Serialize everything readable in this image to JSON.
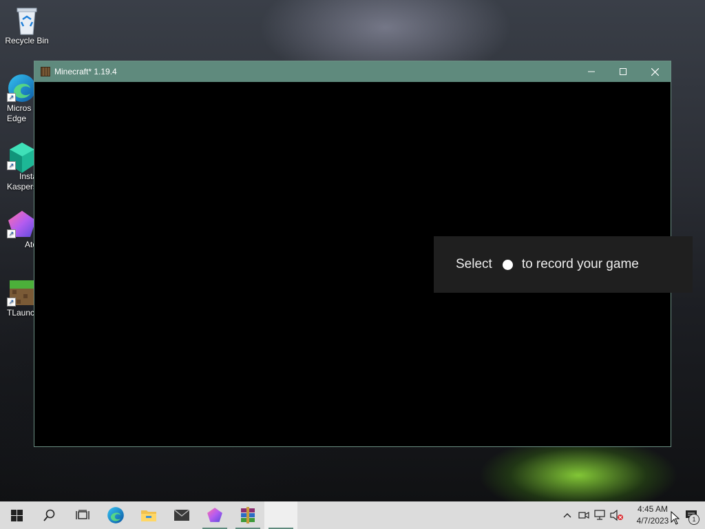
{
  "desktop": {
    "icons": [
      {
        "label": "Recycle Bin",
        "icon": "recycle-bin-icon"
      },
      {
        "label": "Micros\nEdge",
        "icon": "edge-icon"
      },
      {
        "label": "Insta\nKaspers",
        "icon": "kaspersky-icon"
      },
      {
        "label": "Aton",
        "icon": "aton-icon"
      },
      {
        "label": "TLaunc",
        "icon": "tlauncher-icon"
      }
    ]
  },
  "window": {
    "title": "Minecraft* 1.19.4",
    "controls": [
      "minimize",
      "maximize",
      "close"
    ]
  },
  "toast": {
    "text_before": "Select",
    "text_after": "to record your game",
    "icon": "record-dot-icon"
  },
  "taskbar": {
    "pinned": [
      "start-icon",
      "search-icon",
      "task-view-icon",
      "edge-icon",
      "file-explorer-icon",
      "mail-icon",
      "aton-icon",
      "winrar-icon"
    ],
    "clock": {
      "time": "4:45 AM",
      "date": "4/7/2023"
    },
    "notification_count": "1"
  },
  "colors": {
    "titlebar": "#5f8a7d",
    "taskbar": "#dcdcdc",
    "toast_bg": "#1f1f1f"
  }
}
